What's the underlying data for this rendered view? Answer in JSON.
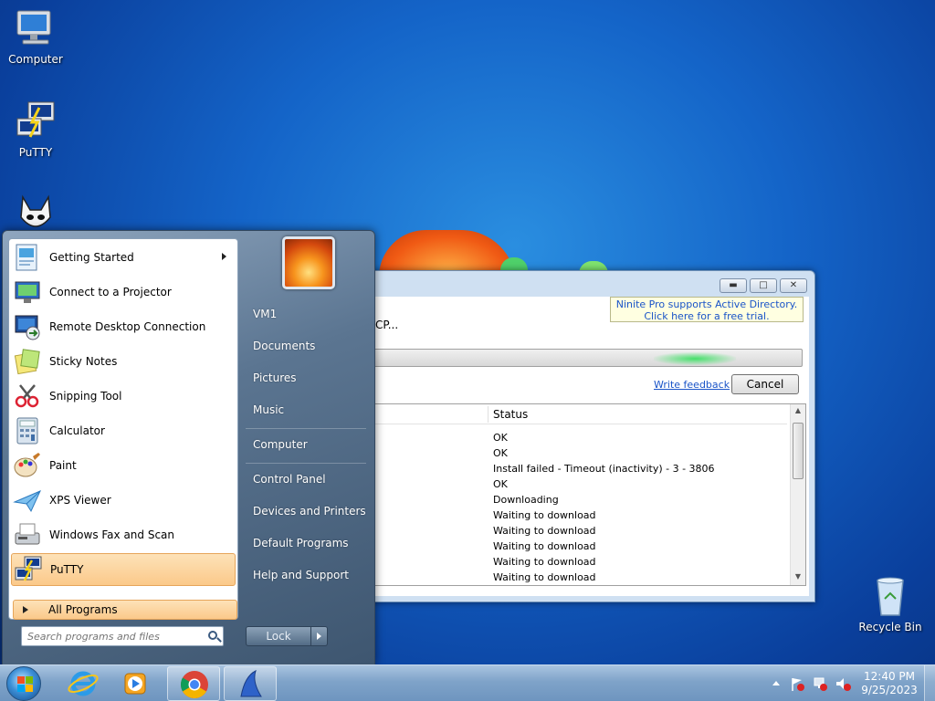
{
  "desktop": {
    "icons": [
      {
        "label": "Computer",
        "icon": "computer-icon"
      },
      {
        "label": "PuTTY",
        "icon": "putty-icon"
      },
      {
        "label": "",
        "icon": "foobar-icon"
      },
      {
        "label": "Recycle Bin",
        "icon": "recycle-bin-icon"
      }
    ]
  },
  "ninite": {
    "promo_line1": "Ninite Pro supports Active Directory.",
    "promo_line2": "Click here for a free trial.",
    "status_text": "CP...",
    "progress": 0.75,
    "feedback_link": "Write feedback",
    "cancel_label": "Cancel",
    "column_status": "Status",
    "rows": [
      "OK",
      "OK",
      "Install failed - Timeout (inactivity) - 3 - 3806",
      "OK",
      "Downloading",
      "Waiting to download",
      "Waiting to download",
      "Waiting to download",
      "Waiting to download",
      "Waiting to download"
    ]
  },
  "start_menu": {
    "programs": [
      {
        "label": "Getting Started",
        "icon": "getting-started-icon",
        "submenu": true
      },
      {
        "label": "Connect to a Projector",
        "icon": "projector-icon"
      },
      {
        "label": "Remote Desktop Connection",
        "icon": "remote-desktop-icon"
      },
      {
        "label": "Sticky Notes",
        "icon": "sticky-notes-icon"
      },
      {
        "label": "Snipping Tool",
        "icon": "snipping-tool-icon"
      },
      {
        "label": "Calculator",
        "icon": "calculator-icon"
      },
      {
        "label": "Paint",
        "icon": "paint-icon"
      },
      {
        "label": "XPS Viewer",
        "icon": "xps-viewer-icon"
      },
      {
        "label": "Windows Fax and Scan",
        "icon": "fax-scan-icon"
      },
      {
        "label": "PuTTY",
        "icon": "putty-icon",
        "highlighted": true
      }
    ],
    "all_programs": "All Programs",
    "search_placeholder": "Search programs and files",
    "right_items": [
      "VM1",
      "Documents",
      "Pictures",
      "Music",
      "Computer",
      "Control Panel",
      "Devices and Printers",
      "Default Programs",
      "Help and Support"
    ],
    "lock_label": "Lock"
  },
  "taskbar": {
    "apps": [
      "internet-explorer-icon",
      "media-player-icon",
      "chrome-icon",
      "ninite-icon"
    ],
    "clock_time": "12:40 PM",
    "clock_date": "9/25/2023"
  }
}
